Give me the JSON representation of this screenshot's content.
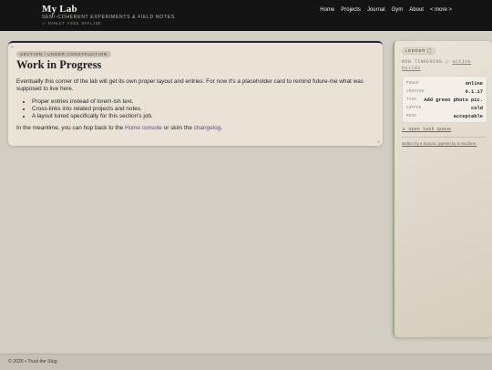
{
  "brand": {
    "title": "My Lab",
    "subtitle": "SEMI-COHERENT EXPERIMENTS & FIELD NOTES",
    "status": "◇  OAMLET FEED OFFLINE"
  },
  "nav": [
    "Home",
    "Projects",
    "Journal",
    "Gym",
    "About",
    "< more >"
  ],
  "card": {
    "pill": "SECTION / UNDER CONSTRUCTION",
    "title": "Work in Progress",
    "intro": "Eventually this corner of the lab will get its own proper layout and entries. For now it's a placeholder card to remind future-me what was supposed to live here.",
    "bullets": [
      "Proper entries instead of lorem-ish text.",
      "Cross-links into related projects and notes.",
      "A layout tuned specifically for this section's job."
    ],
    "outro_pre": "In the meantime, you can hop back to the ",
    "home_link": "Home console",
    "outro_mid": " or skim the ",
    "changelog_link": "changelog",
    "outro_post": "."
  },
  "sidebar": {
    "pill": "LEDGER ◯",
    "now_prefix": "NOW TINKERING ◇ ",
    "now_link": "active builds",
    "ledger": [
      {
        "key": "POWER",
        "value": "online"
      },
      {
        "key": "VERSION",
        "value": "0.1.17"
      },
      {
        "key": "TASK",
        "value": "Add green photo pic."
      },
      {
        "key": "COFFEE",
        "value": "cold"
      },
      {
        "key": "MOOD",
        "value": "acceptable"
      }
    ],
    "task_link": "↳ open task queue",
    "credit": "written by a human, typeset by a machine."
  },
  "footer": {
    "text": "© 2025 • Trust the Slug"
  }
}
